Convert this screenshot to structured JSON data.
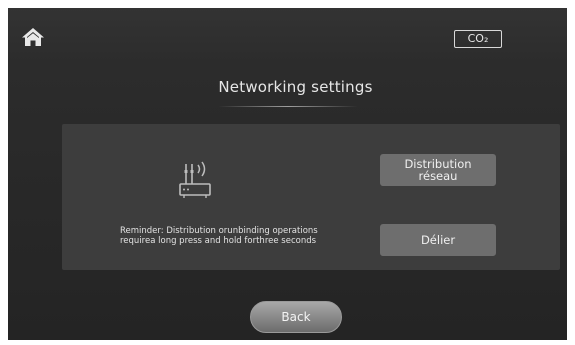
{
  "header": {
    "home_icon": "home-icon",
    "co2_label": "CO₂"
  },
  "title": "Networking settings",
  "panel": {
    "router_icon": "wifi-router-icon",
    "reminder": "Reminder: Distribution orunbinding operations requirea long press and hold forthree seconds",
    "distribution_label": "Distribution\nréseau",
    "unbind_label": "Délier"
  },
  "footer": {
    "back_label": "Back"
  },
  "colors": {
    "background": "#2c2c2c",
    "panel": "#3d3d3d",
    "button": "#6e6e6e",
    "text": "#e6e6e6"
  }
}
